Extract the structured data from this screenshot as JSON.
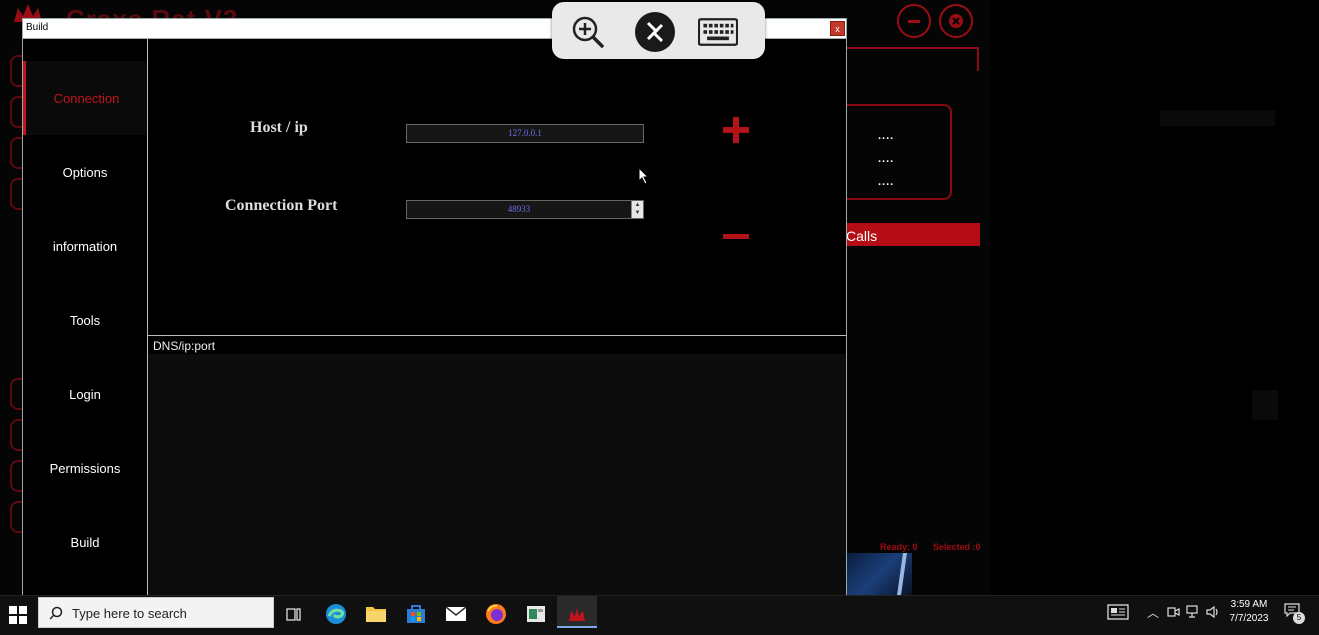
{
  "background_app": {
    "title": "Craxs Rat V3",
    "dots": [
      "....",
      "....",
      "...."
    ],
    "calls_label": "Calls",
    "status_ready": "Ready: 0",
    "status_selected": "Selected :0"
  },
  "build_window": {
    "title": "Build",
    "close_label": "x",
    "sidebar": {
      "items": [
        {
          "label": "Connection",
          "active": true
        },
        {
          "label": "Options",
          "active": false
        },
        {
          "label": "information",
          "active": false
        },
        {
          "label": "Tools",
          "active": false
        },
        {
          "label": "Login",
          "active": false
        },
        {
          "label": "Permissions",
          "active": false
        },
        {
          "label": "Build",
          "active": false
        }
      ]
    },
    "connection": {
      "host_label": "Host / ip",
      "host_value": "127.0.0.1",
      "port_label": "Connection Port",
      "port_value": "48933"
    },
    "list": {
      "header": "DNS/ip:port"
    }
  },
  "remote_toolbar": {
    "icons": [
      "zoom-in-icon",
      "remote-desktop-icon",
      "keyboard-icon"
    ]
  },
  "taskbar": {
    "search_placeholder": "Type here to search",
    "clock_time": "3:59 AM",
    "clock_date": "7/7/2023",
    "notification_count": "5"
  },
  "colors": {
    "accent_red": "#b3121b",
    "input_text": "#6f6fe8",
    "background": "#000000"
  }
}
